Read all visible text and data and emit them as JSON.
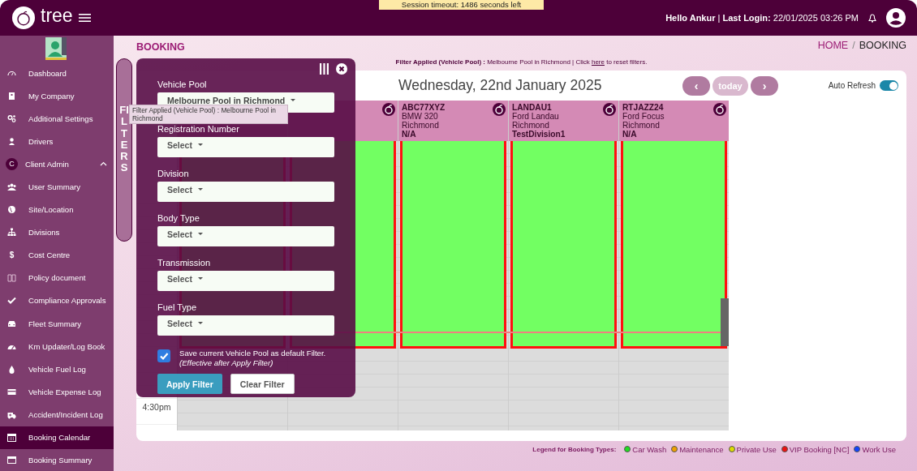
{
  "header": {
    "logo_text": "tree",
    "session_notice": "Session timeout: 1486 seconds left",
    "user_info": "**Hello Ankur** | **Last Login:** 22/01/2025 03:26 PM"
  },
  "sidebar": {
    "items": [
      {
        "label": "Dashboard",
        "selected": false
      },
      {
        "label": "My Company",
        "selected": false
      },
      {
        "label": "Additional Settings",
        "selected": false
      },
      {
        "label": "Drivers",
        "selected": false
      },
      {
        "label": "Client Admin",
        "selected": false,
        "kind": "group",
        "badge": "C",
        "expanded": true
      },
      {
        "label": "User Summary",
        "selected": false
      },
      {
        "label": "Site/Location",
        "selected": false
      },
      {
        "label": "Divisions",
        "selected": false
      },
      {
        "label": "Cost Centre",
        "selected": false,
        "glyph": "$"
      },
      {
        "label": "Policy document",
        "selected": false
      },
      {
        "label": "Compliance Approvals",
        "selected": false
      },
      {
        "label": "Fleet Summary",
        "selected": false
      },
      {
        "label": "Km Updater/Log Book",
        "selected": false
      },
      {
        "label": "Vehicle Fuel Log",
        "selected": false
      },
      {
        "label": "Vehicle Expense Log",
        "selected": false
      },
      {
        "label": "Accident/Incident Log",
        "selected": false
      },
      {
        "label": "Booking Calendar",
        "selected": true
      },
      {
        "label": "Booking Summary",
        "selected": false
      }
    ]
  },
  "page": {
    "title": "BOOKING",
    "breadcrumb_separator": "/",
    "breadcrumb": [
      {
        "label": "HOME",
        "link": true
      },
      {
        "label": "BOOKING",
        "link": false
      }
    ],
    "filter_status": {
      "before": "**Filter Applied (Vehicle Pool) :** Melbourne Pool in Richmond | Click ",
      "link": "here",
      "after": " to reset filters."
    }
  },
  "filters_tab": "FILTERS",
  "tooltip": "Filter Applied (Vehicle Pool) : Melbourne Pool in Richmond",
  "filter_panel": {
    "fields": [
      {
        "label": "Vehicle Pool",
        "value": "Melbourne Pool in Richmond"
      },
      {
        "label": "Registration Number",
        "value": "Select"
      },
      {
        "label": "Division",
        "value": "Select"
      },
      {
        "label": "Body Type",
        "value": "Select"
      },
      {
        "label": "Transmission",
        "value": "Select"
      },
      {
        "label": "Fuel Type",
        "value": "Select"
      }
    ],
    "save_default": {
      "checked": true,
      "text": "Save current Vehicle Pool as default Filter. *(Effective after Apply Filter)*"
    },
    "buttons": [
      {
        "label": "Apply Filter",
        "kind": "primary"
      },
      {
        "label": "Clear Filter",
        "kind": "secondary"
      }
    ]
  },
  "calendar": {
    "date": "Wednesday, 22nd January 2025",
    "nav": [
      {
        "label": "‹",
        "kind": "prev",
        "disabled": false
      },
      {
        "label": "today",
        "kind": "today",
        "disabled": true
      },
      {
        "label": "›",
        "kind": "next",
        "disabled": false
      }
    ],
    "auto_refresh": {
      "label": "Auto Refresh",
      "on": true
    },
    "vehicles": [
      {
        "kind": "hidden"
      },
      {
        "kind": "covered"
      },
      {
        "kind": "vehicle",
        "reg": "ABC77XYZ",
        "model": "BMW 320",
        "location": "Richmond",
        "division": "N/A"
      },
      {
        "kind": "vehicle",
        "reg": "LANDAU1",
        "model": "Ford Landau",
        "location": "Richmond",
        "division": "TestDivision1"
      },
      {
        "kind": "vehicle",
        "reg": "RTJAZZ24",
        "model": "Ford Focus",
        "location": "Richmond",
        "division": "N/A"
      }
    ],
    "time_labels": [
      "4:30pm"
    ]
  },
  "legend": {
    "title": "Legend for Booking Types:",
    "items": [
      {
        "label": "Car Wash",
        "color": "#22dd22"
      },
      {
        "label": "Maintenance",
        "color": "#f0a000"
      },
      {
        "label": "Private Use",
        "color": "#dddd00"
      },
      {
        "label": "VIP Booking [NC]",
        "color": "#ee1111"
      },
      {
        "label": "Work Use",
        "color": "#1144ff"
      }
    ]
  }
}
